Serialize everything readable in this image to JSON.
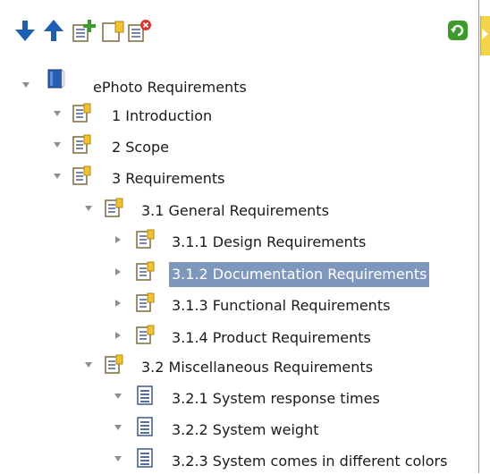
{
  "toolbar": {
    "buttons": [
      {
        "icon": "arrow-down-icon"
      },
      {
        "icon": "arrow-up-icon"
      },
      {
        "icon": "add-child-requirement-icon"
      },
      {
        "icon": "add-requirement-icon"
      },
      {
        "icon": "delete-requirement-icon"
      },
      {
        "icon": "refresh-icon"
      }
    ]
  },
  "tree": {
    "root": {
      "label": "ePhoto Requirements",
      "icon": "project-book-icon",
      "expanded": true
    },
    "items": [
      {
        "label": "1 Introduction",
        "icon": "requirement-folder-icon",
        "expanded": true
      },
      {
        "label": "2 Scope",
        "icon": "requirement-folder-icon",
        "expanded": true
      },
      {
        "label": "3 Requirements",
        "icon": "requirement-folder-icon",
        "expanded": true
      },
      {
        "label": "3.1 General Requirements",
        "icon": "requirement-folder-icon",
        "expanded": true
      },
      {
        "label": "3.1.1 Design Requirements",
        "icon": "requirement-folder-icon",
        "expanded": false
      },
      {
        "label": "3.1.2 Documentation Requirements",
        "icon": "requirement-folder-icon",
        "expanded": false,
        "selected": true
      },
      {
        "label": "3.1.3 Functional Requirements",
        "icon": "requirement-folder-icon",
        "expanded": false
      },
      {
        "label": "3.1.4 Product Requirements",
        "icon": "requirement-folder-icon",
        "expanded": false
      },
      {
        "label": "3.2 Miscellaneous Requirements",
        "icon": "requirement-folder-icon",
        "expanded": true
      },
      {
        "label": "3.2.1 System response times",
        "icon": "requirement-doc-icon",
        "expanded": true
      },
      {
        "label": "3.2.2 System weight",
        "icon": "requirement-doc-icon",
        "expanded": true
      },
      {
        "label": "3.2.3 System comes in different colors",
        "icon": "requirement-doc-icon",
        "expanded": true
      }
    ]
  },
  "colors": {
    "selection": "#7e97bd",
    "accent_arrow": "#1f5fb0",
    "refresh": "#3c9a2a",
    "edge_tab": "#f5d44a"
  }
}
